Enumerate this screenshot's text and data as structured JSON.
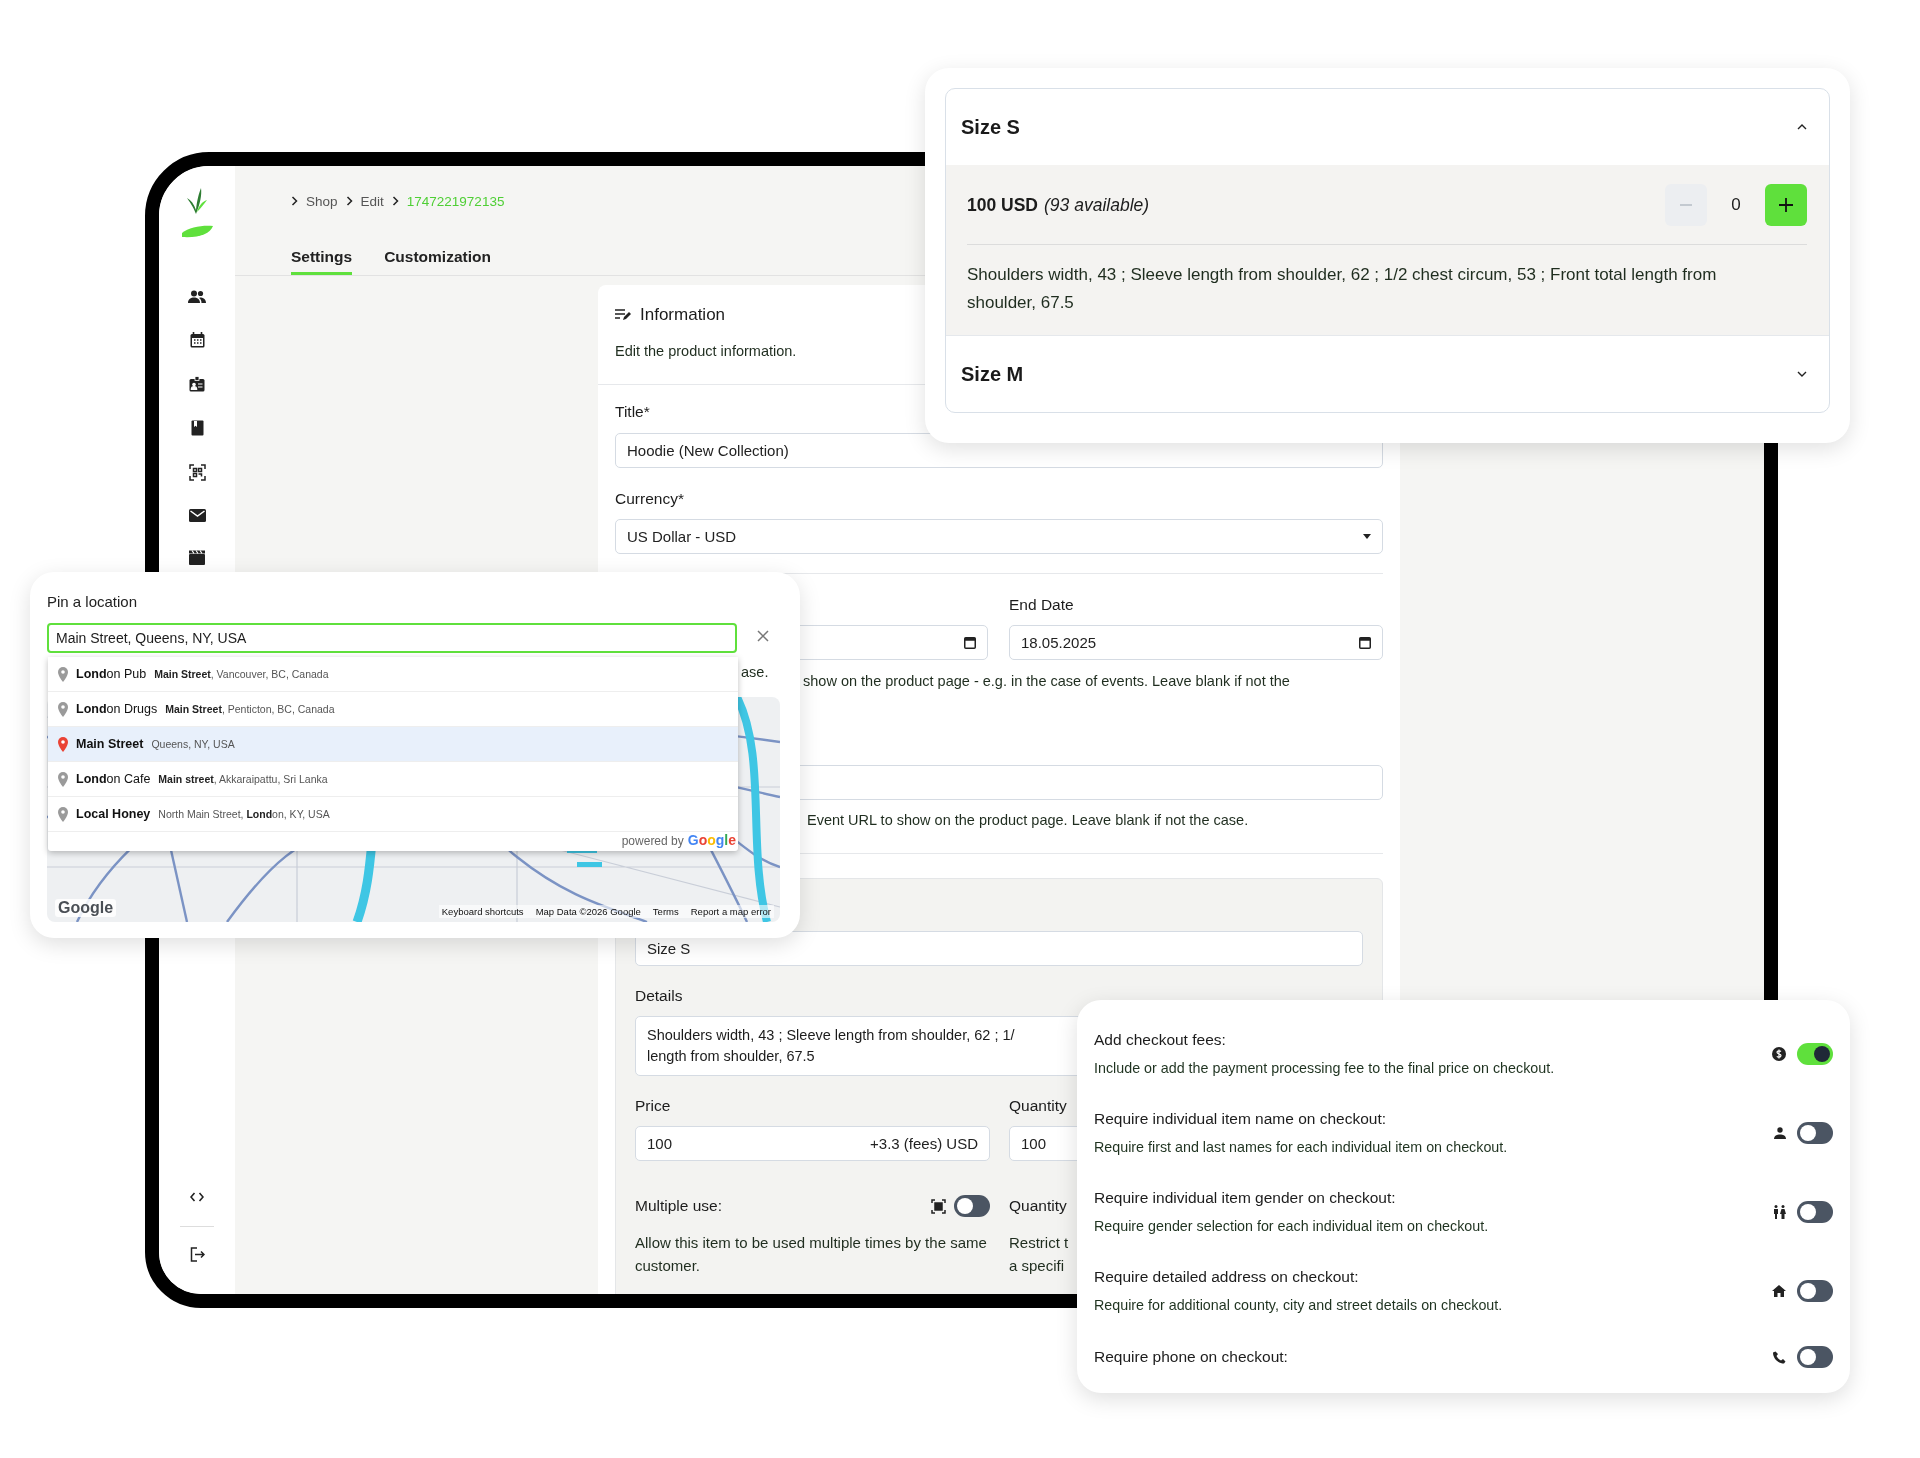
{
  "breadcrumb": [
    {
      "label": "Shop",
      "current": false
    },
    {
      "label": "Edit",
      "current": false
    },
    {
      "label": "1747221972135",
      "current": true
    }
  ],
  "tabs": [
    {
      "label": "Settings",
      "selected": true
    },
    {
      "label": "Customization",
      "selected": false
    }
  ],
  "information": {
    "title": "Information",
    "description": "Edit the product information.",
    "title_field": {
      "label": "Title*",
      "value": "Hoodie (New Collection)"
    },
    "currency_field": {
      "label": "Currency*",
      "value": "US Dollar - USD"
    },
    "end_date": {
      "label": "End Date",
      "value": "18.05.2025"
    },
    "dates_hint": "show on the product page - e.g. in the case of events. Leave blank if not the",
    "url_hint": "Event URL to show on the product page. Leave blank if not the case."
  },
  "variant": {
    "name_value": "Size S",
    "details_label": "Details",
    "details_lines": [
      "Shoulders width, 43 ; Sleeve length from shoulder, 62 ; 1/",
      "length from shoulder, 67.5"
    ],
    "price_label": "Price",
    "price_value": "100",
    "price_suffix": "+3.3 (fees) USD",
    "quantity_label": "Quantity",
    "quantity_value": "100",
    "multiple_use": {
      "label": "Multiple use:",
      "on": false,
      "description": "Allow this item to be used multiple times by the same customer."
    },
    "quantity_limit": {
      "label": "Quantity",
      "description_lines": [
        "Restrict t",
        "a specifi"
      ]
    }
  },
  "location_picker": {
    "title": "Pin a location",
    "query": "Main Street, Queens, NY, USA",
    "hint_fragment": "ase.",
    "suggestions": [
      {
        "main": "**Lond**on Pub",
        "secondary": "**Main Street**, Vancouver, BC, Canada",
        "selected": false
      },
      {
        "main": "**Lond**on Drugs",
        "secondary": "**Main Street**, Penticton, BC, Canada",
        "selected": false
      },
      {
        "main": "**Main Street**",
        "secondary": "Queens, NY, USA",
        "selected": true
      },
      {
        "main": "**Lond**on Cafe",
        "secondary": "**Main street**, Akkaraipattu, Sri Lanka",
        "selected": false
      },
      {
        "main": "**Local Honey**",
        "secondary": "North Main Street, **Lond**on, KY, USA",
        "selected": false
      }
    ],
    "powered_by": "powered by",
    "powered_logo": "Google",
    "map": {
      "logo": "Google",
      "footer": [
        "Keyboard shortcuts",
        "Map Data ©2026 Google",
        "Terms",
        "Report a map error"
      ]
    }
  },
  "size_panel": {
    "sections": [
      {
        "title": "Size S",
        "expanded": true,
        "price": "100 USD",
        "availability": "(93 available)",
        "quantity": "0",
        "details": "Shoulders width, 43 ; Sleeve length from shoulder, 62 ; 1/2 chest circum, 53 ; Front total length from shoulder, 67.5"
      },
      {
        "title": "Size M",
        "expanded": false
      }
    ]
  },
  "checkout_options": [
    {
      "title": "Add checkout fees:",
      "description": "Include or add the payment processing fee to the final price on checkout.",
      "on": true
    },
    {
      "title": "Require individual item name on checkout:",
      "description": "Require first and last names for each individual item on checkout.",
      "on": false
    },
    {
      "title": "Require individual item gender on checkout:",
      "description": "Require gender selection for each individual item on checkout.",
      "on": false
    },
    {
      "title": "Require detailed address on checkout:",
      "description": "Require for additional county, city and street details on checkout.",
      "on": false
    },
    {
      "title": "Require phone on checkout:",
      "on": false
    }
  ]
}
